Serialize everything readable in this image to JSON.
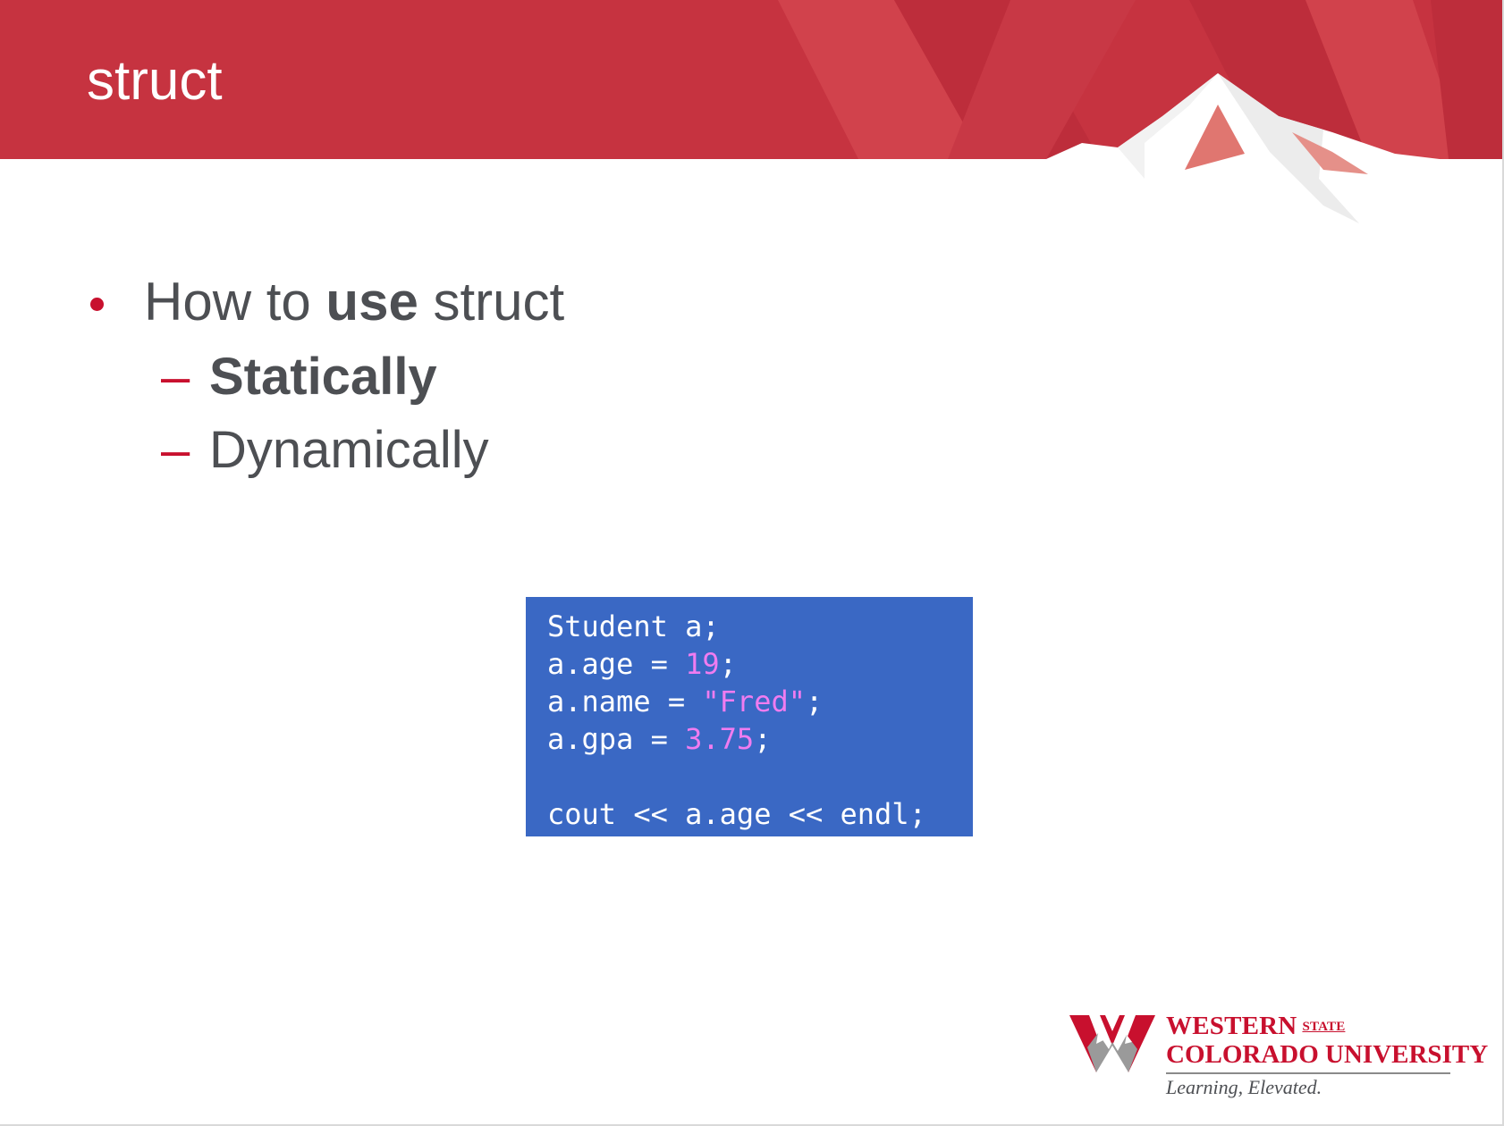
{
  "slide": {
    "title": "struct",
    "bullet": {
      "prefix": "How to ",
      "bold": "use",
      "suffix": " struct"
    },
    "subbullets": [
      {
        "dash": "–",
        "text": "Statically",
        "bold": true
      },
      {
        "dash": "–",
        "text": "Dynamically",
        "bold": false
      }
    ]
  },
  "code": {
    "line1": "Student a;",
    "line2_a": "a.age = ",
    "line2_num": "19",
    "line2_b": ";",
    "line3_a": "a.name = ",
    "line3_str": "\"Fred\"",
    "line3_b": ";",
    "line4_a": "a.gpa = ",
    "line4_num": "3.75",
    "line4_b": ";",
    "line5": "cout << a.age << endl;"
  },
  "logo": {
    "line1": "WESTERN",
    "state": "STATE",
    "line2": "COLORADO UNIVERSITY",
    "tagline": "Learning, Elevated."
  },
  "colors": {
    "banner": "#c63340",
    "accent": "#c8102e",
    "code_bg": "#3a68c4",
    "code_literal": "#f07cf0",
    "body_text": "#4d4f53"
  }
}
